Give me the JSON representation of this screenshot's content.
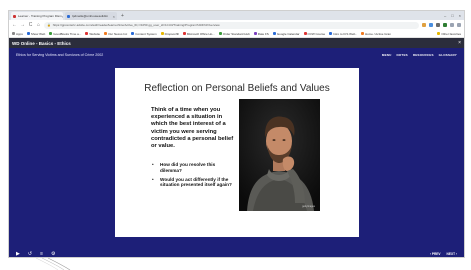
{
  "browser": {
    "tabs": [
      {
        "label": "Learner - Training Program Dism",
        "active": true
      },
      {
        "label": "Ipdmelle@umhousesolidim",
        "active": false
      }
    ],
    "new_tab": "+",
    "window_controls": [
      "–",
      "□",
      "×"
    ],
    "nav": {
      "back": "←",
      "forward": "→",
      "reload": "C",
      "home": "⌂"
    },
    "url": "https://gpcentertc.adobe.com/auth/reader/learner/InterActive_ID,=/1050 gg_user_id=1CU3/Training/Program?ADFN/Overview",
    "bookmarks": [
      {
        "label": "Apps"
      },
      {
        "label": "Show Web"
      },
      {
        "label": "GoodBooks Time a..."
      },
      {
        "label": "Website"
      },
      {
        "label": "Our Nexus Inc"
      },
      {
        "label": "Content System"
      },
      {
        "label": "Dropsonfill"
      },
      {
        "label": "Microsoft Office Ho..."
      },
      {
        "label": "Order Standard Hub"
      },
      {
        "label": "Rate FS"
      },
      {
        "label": "Google Calendar"
      },
      {
        "label": "OVW Course"
      },
      {
        "label": "Intro to ICS Web.."
      },
      {
        "label": "Home / Active Gran"
      }
    ],
    "bookmarks_right": "Other favorites"
  },
  "app": {
    "title": "WD Online - Basics - Ethics",
    "close": "×"
  },
  "course": {
    "title": "Ethics for Serving Victims and Survivors of Crime 2002",
    "menu": [
      "MENU",
      "NOTES",
      "RESOURCES",
      "GLOSSARY"
    ]
  },
  "slide": {
    "title": "Reflection on Personal Beliefs and Values",
    "prompt": "Think of a time when you experienced a situation in which the best interest of a victim you were serving contradicted a personal belief or value.",
    "bullets": [
      "How did you resolve this dilemma?",
      "Would you act differently if the situation presented itself again?"
    ],
    "photo_credit": "gettyimages"
  },
  "player": {
    "controls": [
      "▶",
      "↺",
      "≡",
      "⚙"
    ],
    "prev": "‹ PREV",
    "next": "NEXT ›"
  },
  "colors": {
    "player_bg": "#1d1f78",
    "header_bg": "#2b2d3b",
    "slide_bg": "#ffffff"
  }
}
